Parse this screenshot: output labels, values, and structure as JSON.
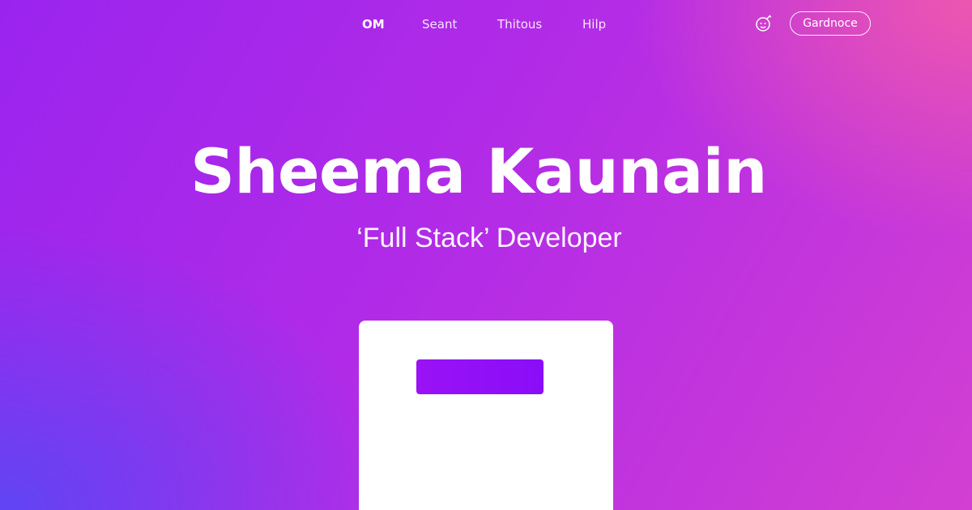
{
  "nav": {
    "links": [
      {
        "label": "OM"
      },
      {
        "label": "Seant"
      },
      {
        "label": "Thitous"
      },
      {
        "label": "Hilp"
      }
    ],
    "profile_icon": "avatar-face-icon",
    "cta_label": "Gardnoce"
  },
  "hero": {
    "title": "Sheema Kaunain",
    "subtitle": "‘Full Stack’ Developer"
  },
  "card": {
    "button_label": ""
  },
  "colors": {
    "gradient_violet": "#9a24ee",
    "gradient_pink": "#f45ca8",
    "gradient_blue": "#5848f5",
    "card_bg": "#ffffff",
    "card_button": "#9a12f5"
  }
}
